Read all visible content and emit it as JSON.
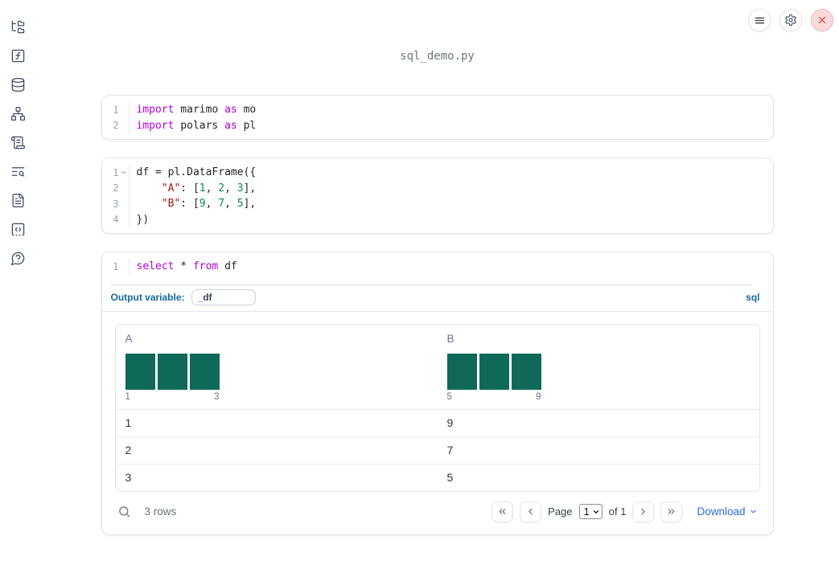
{
  "app": {
    "title": "sql_demo.py"
  },
  "topbar": {
    "buttons": [
      {
        "name": "menu",
        "icon": "hamburger-icon"
      },
      {
        "name": "settings",
        "icon": "gear-icon"
      },
      {
        "name": "shutdown",
        "icon": "close-icon"
      }
    ]
  },
  "sidebar": {
    "items": [
      {
        "name": "file-explorer",
        "icon": "file-tree-icon"
      },
      {
        "name": "variables",
        "icon": "function-square-icon"
      },
      {
        "name": "datasources",
        "icon": "database-icon"
      },
      {
        "name": "dependency-graph",
        "icon": "network-icon"
      },
      {
        "name": "scratchpad",
        "icon": "scroll-icon"
      },
      {
        "name": "logs",
        "icon": "list-search-icon"
      },
      {
        "name": "documentation",
        "icon": "document-icon"
      },
      {
        "name": "snippets",
        "icon": "code-box-icon"
      },
      {
        "name": "help",
        "icon": "help-bubble-icon"
      }
    ]
  },
  "colors": {
    "keyword": "#af00db",
    "string": "#a31515",
    "number": "#098658",
    "code_text": "#1f2328",
    "histogram_bar": "#0e6958",
    "accent_blue": "#15689c",
    "link_blue": "#2e6bd8"
  },
  "cells": [
    {
      "id": "imports",
      "lines": [
        {
          "num": "1",
          "fold": false,
          "tokens": [
            [
              "import",
              "kw"
            ],
            [
              " marimo ",
              "pl"
            ],
            [
              "as",
              "kw"
            ],
            [
              " mo",
              "pl"
            ]
          ]
        },
        {
          "num": "2",
          "fold": false,
          "tokens": [
            [
              "import",
              "kw"
            ],
            [
              " polars ",
              "pl"
            ],
            [
              "as",
              "kw"
            ],
            [
              " pl",
              "pl"
            ]
          ]
        }
      ]
    },
    {
      "id": "dataframe",
      "lines": [
        {
          "num": "1",
          "fold": true,
          "tokens": [
            [
              "df = pl.DataFrame({",
              "pl"
            ]
          ]
        },
        {
          "num": "2",
          "fold": false,
          "tokens": [
            [
              "    ",
              "pl"
            ],
            [
              "\"A\"",
              "str"
            ],
            [
              ": [",
              "pl"
            ],
            [
              "1",
              "num"
            ],
            [
              ", ",
              "pl"
            ],
            [
              "2",
              "num"
            ],
            [
              ", ",
              "pl"
            ],
            [
              "3",
              "num"
            ],
            [
              "],",
              "pl"
            ]
          ]
        },
        {
          "num": "3",
          "fold": false,
          "tokens": [
            [
              "    ",
              "pl"
            ],
            [
              "\"B\"",
              "str"
            ],
            [
              ": [",
              "pl"
            ],
            [
              "9",
              "num"
            ],
            [
              ", ",
              "pl"
            ],
            [
              "7",
              "num"
            ],
            [
              ", ",
              "pl"
            ],
            [
              "5",
              "num"
            ],
            [
              "],",
              "pl"
            ]
          ]
        },
        {
          "num": "4",
          "fold": false,
          "tokens": [
            [
              "})",
              "pl"
            ]
          ]
        }
      ]
    },
    {
      "id": "sql",
      "lines": [
        {
          "num": "1",
          "fold": false,
          "tokens": [
            [
              "select",
              "kw"
            ],
            [
              " * ",
              "pl"
            ],
            [
              "from",
              "kw"
            ],
            [
              " df",
              "pl"
            ]
          ]
        }
      ]
    }
  ],
  "sql_cell": {
    "output_variable_label": "Output variable:",
    "output_variable_value": "_df",
    "language_label": "sql"
  },
  "table": {
    "columns": [
      {
        "name": "A",
        "histogram": {
          "values": [
            1,
            1,
            1
          ],
          "min_label": "1",
          "max_label": "3"
        }
      },
      {
        "name": "B",
        "histogram": {
          "values": [
            1,
            1,
            1
          ],
          "min_label": "5",
          "max_label": "9"
        }
      }
    ],
    "rows": [
      [
        "1",
        "9"
      ],
      [
        "2",
        "7"
      ],
      [
        "3",
        "5"
      ]
    ],
    "row_count_label": "3 rows",
    "pagination": {
      "page_label": "Page",
      "page_value": "1",
      "of_label": "of 1"
    },
    "download_label": "Download"
  }
}
